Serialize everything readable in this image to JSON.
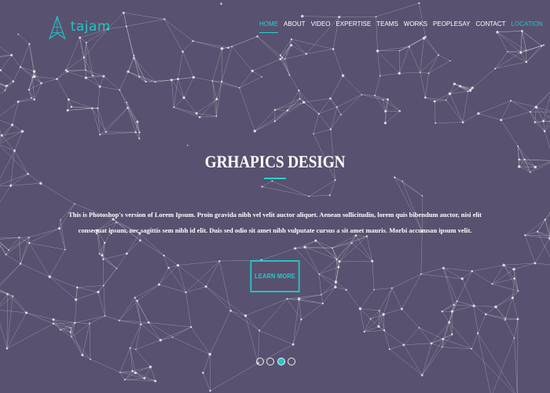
{
  "brand": {
    "name": "tajam",
    "accent_color": "#27d0cf",
    "background_color": "#58516f"
  },
  "navigation": {
    "items": [
      {
        "label": "HOME",
        "active": true
      },
      {
        "label": "ABOUT",
        "active": false
      },
      {
        "label": "VIDEO",
        "active": false
      },
      {
        "label": "EXPERTISE",
        "active": false
      },
      {
        "label": "TEAMS",
        "active": false
      },
      {
        "label": "WORKS",
        "active": false
      },
      {
        "label": "PEOPLESAY",
        "active": false
      },
      {
        "label": "CONTACT",
        "active": false
      },
      {
        "label": "LOCATION",
        "active": false
      }
    ]
  },
  "hero": {
    "title": "GRHAPICS DESIGN",
    "description": "This is Photoshop's version of Lorem Ipsum. Proin gravida nibh vel velit auctor aliquet. Aenean sollicitudin, lorem quis bibendum auctor, nisi elit consequat ipsum, nec sagittis sem nibh id elit. Duis sed odio sit amet nibh vulputate cursus a sit amet mauris. Morbi accumsan ipsum velit.",
    "button_label": "LEARN MORE"
  },
  "slider": {
    "current_slide": 3,
    "total_slides": 4
  },
  "icons": {
    "logo_icon": "cone-logo-icon"
  }
}
